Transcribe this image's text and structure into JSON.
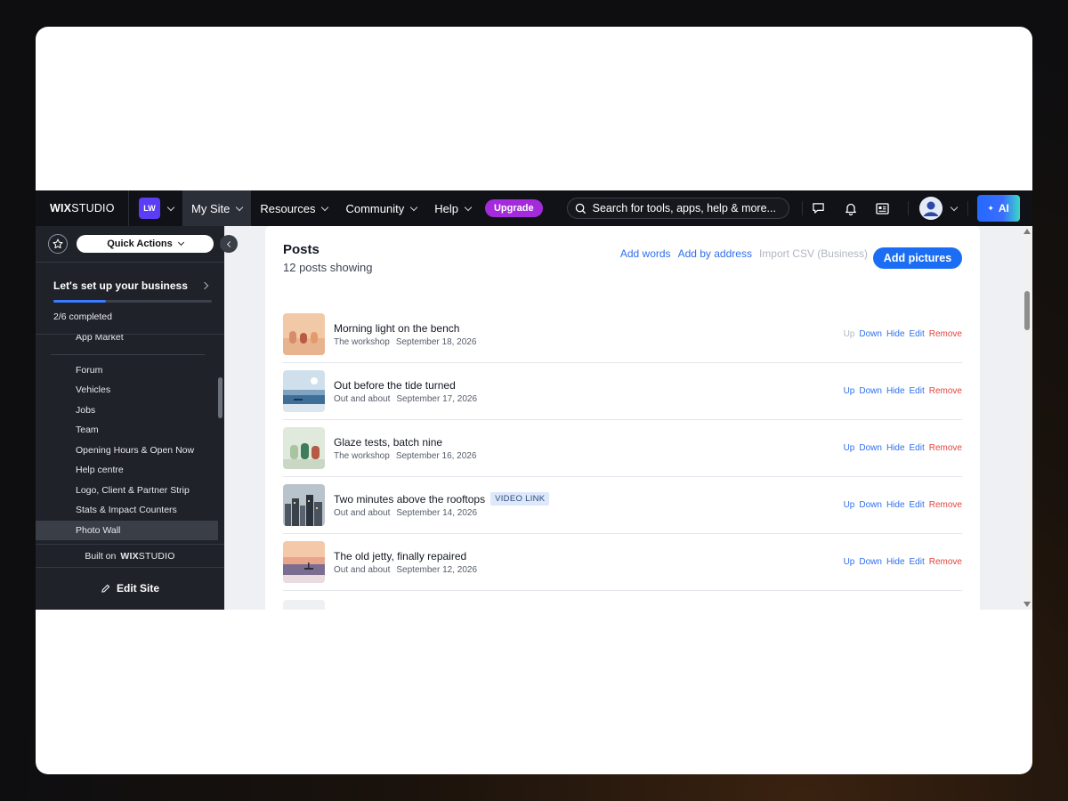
{
  "topbar": {
    "brand_bold": "WIX",
    "brand_thin": "STUDIO",
    "site_initials": "LW",
    "nav": [
      "My Site",
      "Resources",
      "Community",
      "Help"
    ],
    "upgrade": "Upgrade",
    "search_placeholder": "Search for tools, apps, help & more...",
    "ai_label": "AI",
    "colors": {
      "bar": "#101217",
      "upgrade": "#a32bdb",
      "site_avatar": "#5b3df5"
    }
  },
  "sidebar": {
    "quick_actions": "Quick Actions",
    "setup_title": "Let's set up your business",
    "setup_progress": 0.333,
    "setup_count": "2/6 completed",
    "items_top": [
      "App Market"
    ],
    "items": [
      "Forum",
      "Vehicles",
      "Jobs",
      "Team",
      "Opening Hours & Open Now",
      "Help centre",
      "Logo, Client & Partner Strip",
      "Stats & Impact Counters",
      "Photo Wall"
    ],
    "selected": "Photo Wall",
    "built_on": "Built on",
    "built_brand_bold": "WIX",
    "built_brand_thin": "STUDIO",
    "edit_site": "Edit Site"
  },
  "content": {
    "title": "Posts",
    "subtitle": "12 posts showing",
    "links": [
      "Add words",
      "Add by address"
    ],
    "disabled_link": "Import CSV (Business)",
    "primary_button": "Add pictures",
    "row_actions": {
      "up": "Up",
      "down": "Down",
      "hide": "Hide",
      "edit": "Edit",
      "remove": "Remove"
    },
    "posts": [
      {
        "title": "Morning light on the bench",
        "category": "The workshop",
        "date": "September 18, 2026",
        "tag": "",
        "up_disabled": true
      },
      {
        "title": "Out before the tide turned",
        "category": "Out and about",
        "date": "September 17, 2026",
        "tag": "",
        "up_disabled": false
      },
      {
        "title": "Glaze tests, batch nine",
        "category": "The workshop",
        "date": "September 16, 2026",
        "tag": "",
        "up_disabled": false
      },
      {
        "title": "Two minutes above the rooftops",
        "category": "Out and about",
        "date": "September 14, 2026",
        "tag": "VIDEO LINK",
        "up_disabled": false
      },
      {
        "title": "The old jetty, finally repaired",
        "category": "Out and about",
        "date": "September 12, 2026",
        "tag": "",
        "up_disabled": false
      }
    ]
  }
}
